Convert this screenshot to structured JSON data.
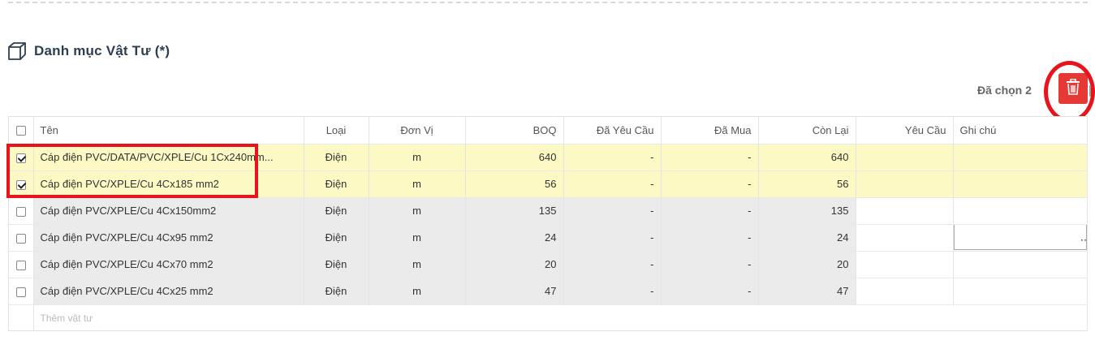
{
  "section": {
    "title": "Danh mục Vật Tư (*)",
    "icon": "cube-icon"
  },
  "toolbar": {
    "selected_text": "Đã chọn 2",
    "delete_icon": "trash-icon",
    "delete_color": "#e53935"
  },
  "table": {
    "headers": {
      "name": "Tên",
      "type": "Loại",
      "unit": "Đơn Vị",
      "boq": "BOQ",
      "requested": "Đã Yêu Cầu",
      "purchased": "Đã Mua",
      "remaining": "Còn Lại",
      "request": "Yêu Cầu",
      "note": "Ghi chú"
    },
    "rows": [
      {
        "checked": true,
        "name": "Cáp điện PVC/DATA/PVC/XPLE/Cu 1Cx240mm...",
        "type": "Điện",
        "unit": "m",
        "boq": "640",
        "requested": "-",
        "purchased": "-",
        "remaining": "640",
        "request": "",
        "note": ""
      },
      {
        "checked": true,
        "name": "Cáp điện PVC/XPLE/Cu 4Cx185 mm2",
        "type": "Điện",
        "unit": "m",
        "boq": "56",
        "requested": "-",
        "purchased": "-",
        "remaining": "56",
        "request": "",
        "note": ""
      },
      {
        "checked": false,
        "name": "Cáp điện PVC/XPLE/Cu 4Cx150mm2",
        "type": "Điện",
        "unit": "m",
        "boq": "135",
        "requested": "-",
        "purchased": "-",
        "remaining": "135",
        "request": "",
        "note": ""
      },
      {
        "checked": false,
        "name": "Cáp điện PVC/XPLE/Cu 4Cx95 mm2",
        "type": "Điện",
        "unit": "m",
        "boq": "24",
        "requested": "-",
        "purchased": "-",
        "remaining": "24",
        "request": "",
        "note": ""
      },
      {
        "checked": false,
        "name": "Cáp điện PVC/XPLE/Cu 4Cx70 mm2",
        "type": "Điện",
        "unit": "m",
        "boq": "20",
        "requested": "-",
        "purchased": "-",
        "remaining": "20",
        "request": "",
        "note": ""
      },
      {
        "checked": false,
        "name": "Cáp điện PVC/XPLE/Cu 4Cx25 mm2",
        "type": "Điện",
        "unit": "m",
        "boq": "47",
        "requested": "-",
        "purchased": "-",
        "remaining": "47",
        "request": "",
        "note": ""
      }
    ],
    "add_placeholder": "Thêm vật tư"
  },
  "colors": {
    "selected_row": "#fcf9c4",
    "readonly_cell": "#ebebeb",
    "annotation": "#e8141c"
  }
}
